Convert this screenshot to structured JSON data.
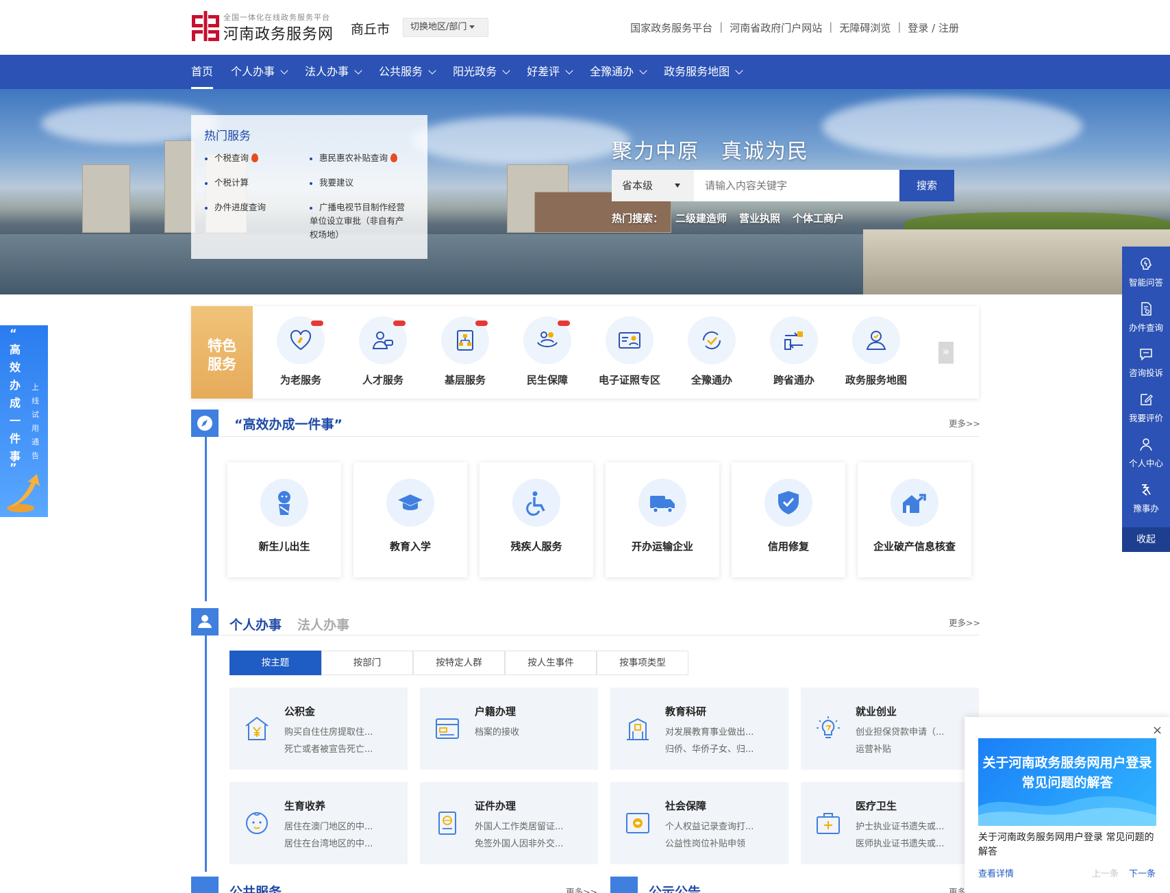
{
  "header": {
    "logo_small": "全国一体化在线政务服务平台",
    "logo_big": "河南政务服务网",
    "city": "商丘市",
    "region_switch": "切换地区/部门",
    "links": [
      "国家政务服务平台",
      "河南省政府门户网站",
      "无障碍浏览"
    ],
    "login": "登录 / 注册",
    "brand_color": "#c8102e"
  },
  "nav": {
    "items": [
      {
        "label": "首页",
        "dropdown": false
      },
      {
        "label": "个人办事",
        "dropdown": true
      },
      {
        "label": "法人办事",
        "dropdown": true
      },
      {
        "label": "公共服务",
        "dropdown": true
      },
      {
        "label": "阳光政务",
        "dropdown": true
      },
      {
        "label": "好差评",
        "dropdown": true
      },
      {
        "label": "全豫通办",
        "dropdown": true
      },
      {
        "label": "政务服务地图",
        "dropdown": true
      }
    ],
    "color": "#2b52b4"
  },
  "hot_services": {
    "title": "热门服务",
    "items": [
      {
        "label": "个税查询",
        "hot": true
      },
      {
        "label": "惠民惠农补贴查询",
        "hot": true
      },
      {
        "label": "个税计算",
        "hot": false
      },
      {
        "label": "我要建议",
        "hot": false
      },
      {
        "label": "办件进度查询",
        "hot": false
      },
      {
        "label": "广播电视节目制作经营",
        "hot": false
      }
    ],
    "item6_line2": "单位设立审批（非自有产",
    "item6_line3": "权场地）"
  },
  "banner": {
    "slogan": "聚力中原　真诚为民",
    "search_level": "省本级",
    "search_placeholder": "请输入内容关键字",
    "search_button": "搜索",
    "hot_search": [
      "热门搜索：",
      "二级建造师",
      "营业执照",
      "个体工商户"
    ]
  },
  "right_float": {
    "items": [
      "智能问答",
      "办件查询",
      "咨询投诉",
      "我要评价",
      "个人中心",
      "豫事办"
    ],
    "collapse": "收起"
  },
  "left_float": {
    "big": [
      "“",
      "高",
      "效",
      "办",
      "成",
      "一",
      "件",
      "事",
      "”"
    ],
    "small": [
      "上",
      "线",
      "试",
      "用",
      "通",
      "告"
    ]
  },
  "featured": {
    "label_line1": "特色",
    "label_line2": "服务",
    "items": [
      {
        "label": "为老服务",
        "icon": "heart-hand-icon",
        "new": true
      },
      {
        "label": "人才服务",
        "icon": "people-icon",
        "new": true
      },
      {
        "label": "基层服务",
        "icon": "org-chart-icon",
        "new": true
      },
      {
        "label": "民生保障",
        "icon": "family-hand-icon",
        "new": true
      },
      {
        "label": "电子证照专区",
        "icon": "id-card-icon",
        "new": false
      },
      {
        "label": "全豫通办",
        "icon": "check-circle-icon",
        "new": false
      },
      {
        "label": "跨省通办",
        "icon": "transfer-icon",
        "new": false
      },
      {
        "label": "政务服务地图",
        "icon": "map-person-icon",
        "new": false
      }
    ],
    "next": "»"
  },
  "efficient": {
    "title": "“高效办成一件事”",
    "more": "更多>>",
    "items": [
      {
        "label": "新生儿出生",
        "icon": "baby-icon"
      },
      {
        "label": "教育入学",
        "icon": "graduation-cap-icon"
      },
      {
        "label": "残疾人服务",
        "icon": "wheelchair-icon"
      },
      {
        "label": "开办运输企业",
        "icon": "truck-icon"
      },
      {
        "label": "信用修复",
        "icon": "shield-check-icon"
      },
      {
        "label": "企业破产信息核查",
        "icon": "house-arrow-icon"
      }
    ]
  },
  "personal": {
    "title": "个人办事",
    "title2": "法人办事",
    "more": "更多>>",
    "tabs": [
      "按主题",
      "按部门",
      "按特定人群",
      "按人生事件",
      "按事项类型"
    ],
    "categories": [
      {
        "title": "公积金",
        "sub1": "购买自住住房提取住...",
        "sub2": "死亡或者被宣告死亡...",
        "icon": "house-yen-icon"
      },
      {
        "title": "户籍办理",
        "sub1": "档案的接收",
        "sub2": "",
        "icon": "register-icon"
      },
      {
        "title": "教育科研",
        "sub1": "对发展教育事业做出...",
        "sub2": "归侨、华侨子女、归...",
        "icon": "school-building-icon"
      },
      {
        "title": "就业创业",
        "sub1": "创业担保贷款申请（...",
        "sub2": "运营补贴",
        "icon": "lightbulb-icon"
      },
      {
        "title": "生育收养",
        "sub1": "居住在澳门地区的中...",
        "sub2": "居住在台湾地区的中...",
        "icon": "baby-face-icon"
      },
      {
        "title": "证件办理",
        "sub1": "外国人工作类居留证...",
        "sub2": "免签外国人因非外交...",
        "icon": "passport-icon"
      },
      {
        "title": "社会保障",
        "sub1": "个人权益记录查询打...",
        "sub2": "公益性岗位补贴申领",
        "icon": "security-card-icon"
      },
      {
        "title": "医疗卫生",
        "sub1": "护士执业证书遗失或...",
        "sub2": "医师执业证书遗失或...",
        "icon": "medical-kit-icon"
      }
    ]
  },
  "bottom_sections": [
    {
      "title": "公共服务",
      "more": "更多>>"
    },
    {
      "title": "公示公告",
      "more": "更多"
    }
  ],
  "notice": {
    "image_text": "关于河南政务服务网用户登录常见问题的解答",
    "text": "关于河南政务服务网用户登录 常见问题的解答",
    "detail": "查看详情",
    "prev": "上一条",
    "next": "下一条",
    "close": "×"
  }
}
